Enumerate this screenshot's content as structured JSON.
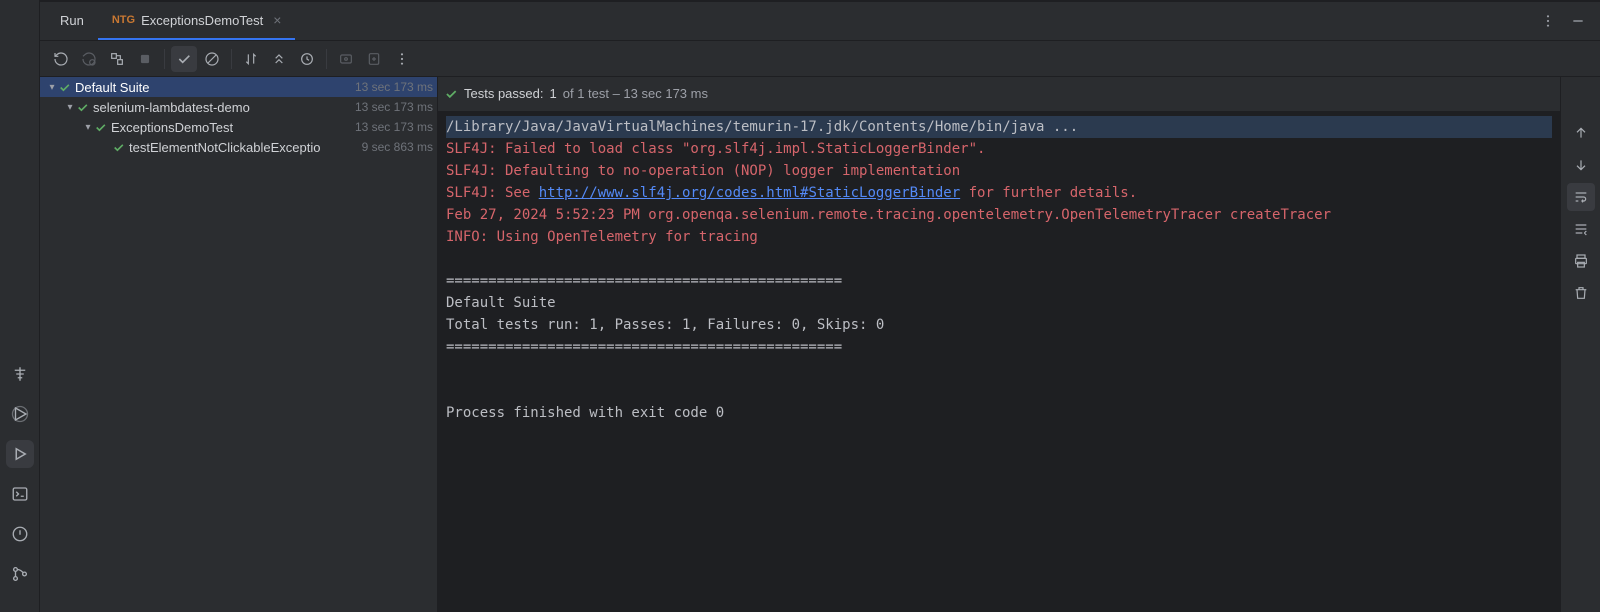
{
  "tabs": {
    "run": "Run",
    "file": "ExceptionsDemoTest"
  },
  "tree": [
    {
      "indent": 0,
      "chev": true,
      "name": "Default Suite",
      "time": "13 sec 173 ms",
      "selected": true
    },
    {
      "indent": 1,
      "chev": true,
      "name": "selenium-lambdatest-demo",
      "time": "13 sec 173 ms",
      "selected": false
    },
    {
      "indent": 2,
      "chev": true,
      "name": "ExceptionsDemoTest",
      "time": "13 sec 173 ms",
      "selected": false
    },
    {
      "indent": 3,
      "chev": false,
      "name": "testElementNotClickableExceptio",
      "time": "9 sec 863 ms",
      "selected": false
    }
  ],
  "status": {
    "passed_label": "Tests passed:",
    "passed_count": "1",
    "of_total": " of 1 test – 13 sec 173 ms"
  },
  "console_lines": [
    {
      "cls": "cmd",
      "text": "/Library/Java/JavaVirtualMachines/temurin-17.jdk/Contents/Home/bin/java ..."
    },
    {
      "cls": "err",
      "text": "SLF4J: Failed to load class \"org.slf4j.impl.StaticLoggerBinder\"."
    },
    {
      "cls": "err",
      "text": "SLF4J: Defaulting to no-operation (NOP) logger implementation"
    },
    {
      "cls": "err",
      "text": "SLF4J: See ",
      "link": "http://www.slf4j.org/codes.html#StaticLoggerBinder",
      "tail": " for further details."
    },
    {
      "cls": "err",
      "text": "Feb 27, 2024 5:52:23 PM org.openqa.selenium.remote.tracing.opentelemetry.OpenTelemetryTracer createTracer"
    },
    {
      "cls": "err",
      "text": "INFO: Using OpenTelemetry for tracing"
    },
    {
      "cls": "plain",
      "text": ""
    },
    {
      "cls": "plain",
      "text": "==============================================="
    },
    {
      "cls": "plain",
      "text": "Default Suite"
    },
    {
      "cls": "plain",
      "text": "Total tests run: 1, Passes: 1, Failures: 0, Skips: 0"
    },
    {
      "cls": "plain",
      "text": "==============================================="
    },
    {
      "cls": "plain",
      "text": ""
    },
    {
      "cls": "plain",
      "text": ""
    },
    {
      "cls": "plain",
      "text": "Process finished with exit code 0"
    }
  ]
}
